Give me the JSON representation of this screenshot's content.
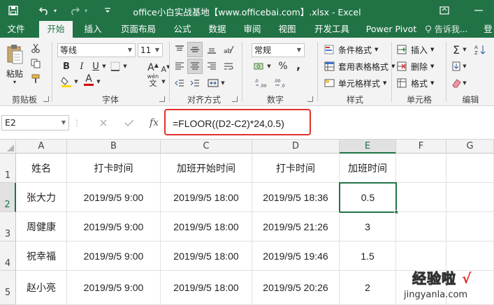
{
  "titlebar": {
    "title": "office小白实战基地【www.officebai.com】.xlsx - Excel",
    "save_icon": "save-icon",
    "undo_icon": "undo-icon",
    "redo_icon": "redo-icon",
    "customize_icon": "customize-quick-access-icon",
    "restore_icon": "ribbon-display-options-icon",
    "minimize_icon": "minimize-icon"
  },
  "tabs": [
    "文件",
    "开始",
    "插入",
    "页面布局",
    "公式",
    "数据",
    "审阅",
    "视图",
    "开发工具",
    "Power Pivot"
  ],
  "active_tab": "开始",
  "tell_me": "告诉我...",
  "sign_in": "登",
  "ribbon": {
    "clipboard": {
      "paste": "粘贴",
      "label": "剪贴板"
    },
    "font": {
      "name": "等线",
      "size": "11",
      "label": "字体",
      "bold": "B",
      "italic": "I",
      "underline": "U",
      "font_color": "A",
      "phonetic": "wén",
      "grow": "A",
      "shrink": "A"
    },
    "alignment": {
      "label": "对齐方式"
    },
    "number": {
      "format": "常规",
      "percent": "%",
      "comma": ",",
      "label": "数字"
    },
    "styles": {
      "conditional": "条件格式",
      "table": "套用表格格式",
      "cell_styles": "单元格样式",
      "label": "样式"
    },
    "cells": {
      "insert": "插入",
      "delete": "删除",
      "format": "格式",
      "label": "单元格"
    },
    "editing": {
      "label": "编辑"
    }
  },
  "formula_bar": {
    "name_box": "E2",
    "formula": "=FLOOR((D2-C2)*24,0.5)"
  },
  "sheet": {
    "columns": [
      "A",
      "B",
      "C",
      "D",
      "E",
      "F",
      "G"
    ],
    "selected_column": "E",
    "rows": [
      "1",
      "2",
      "3",
      "4",
      "5"
    ],
    "selected_row": "2",
    "active_cell": "E2",
    "cells": [
      [
        "姓名",
        "打卡时间",
        "加班开始时间",
        "打卡时间",
        "加班时间",
        "",
        ""
      ],
      [
        "张大力",
        "2019/9/5 9:00",
        "2019/9/5 18:00",
        "2019/9/5 18:36",
        "0.5",
        "",
        ""
      ],
      [
        "周健康",
        "2019/9/5 9:00",
        "2019/9/5 18:00",
        "2019/9/5 21:26",
        "3",
        "",
        ""
      ],
      [
        "祝幸福",
        "2019/9/5 9:00",
        "2019/9/5 18:00",
        "2019/9/5 19:46",
        "1.5",
        "",
        ""
      ],
      [
        "赵小亮",
        "2019/9/5 9:00",
        "2019/9/5 18:00",
        "2019/9/5 20:26",
        "2",
        "",
        ""
      ]
    ]
  },
  "watermark": {
    "line1": "经验啦",
    "check": "√",
    "line2": "jingyanla.com"
  },
  "colors": {
    "excel_green": "#217346",
    "highlight_red": "#e0312b",
    "font_red": "#d40000",
    "fill_yellow": "#ffd700"
  }
}
